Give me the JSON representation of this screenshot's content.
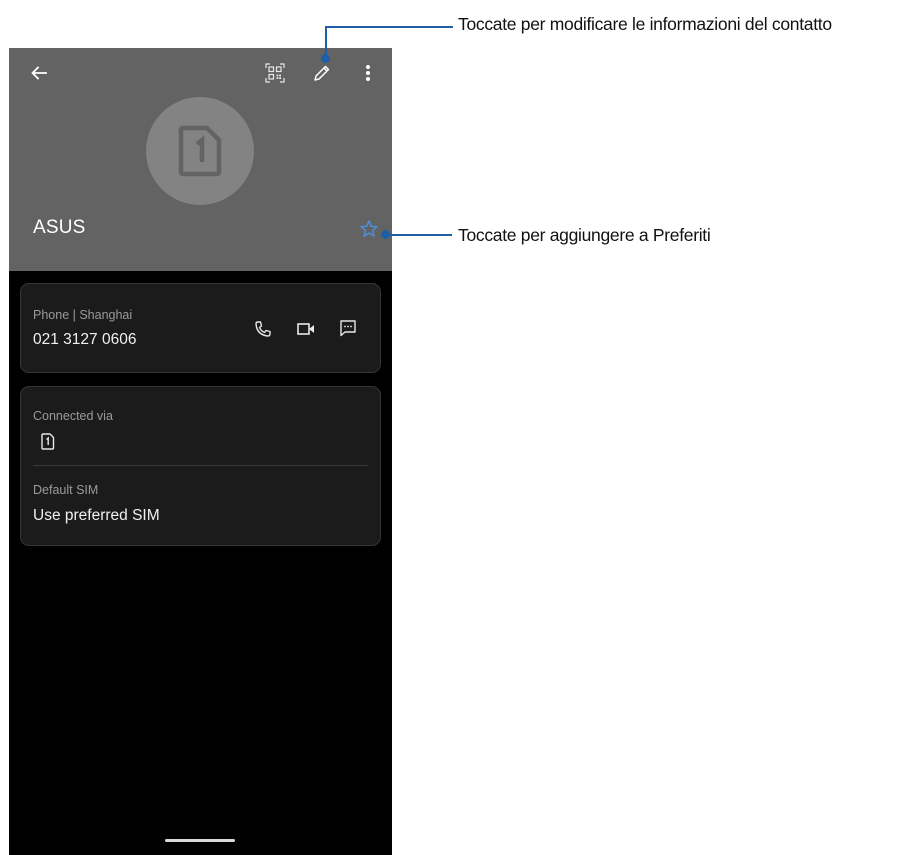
{
  "contact": {
    "name": "ASUS",
    "avatar_icon": "sim-card-1-icon"
  },
  "toolbar": {
    "back_icon": "arrow-back-icon",
    "qr_icon": "qr-code-icon",
    "edit_icon": "pencil-icon",
    "more_icon": "more-vert-icon",
    "favorite_icon": "star-outline-icon"
  },
  "phone_card": {
    "label": "Phone | Shanghai",
    "number": "021 3127 0606",
    "actions": [
      "phone-icon",
      "video-call-icon",
      "message-icon"
    ]
  },
  "sim_card": {
    "connected_label": "Connected via",
    "connected_icon": "sim-card-1-icon",
    "default_label": "Default SIM",
    "default_value": "Use preferred SIM"
  },
  "callouts": {
    "edit": "Toccate per modificare le informazioni del contatto",
    "favorite": "Toccate per aggiungere a Preferiti"
  },
  "colors": {
    "header": "#636363",
    "background": "#000000",
    "card": "#1b1b1b",
    "callout": "#1f5fa8",
    "star": "#4f8fe0"
  }
}
